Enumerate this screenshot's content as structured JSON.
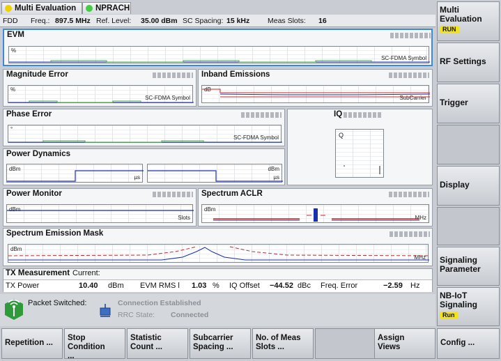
{
  "tabs": {
    "multi_eval": "Multi Evaluation",
    "nprach": "NPRACH"
  },
  "info": {
    "duplex": "FDD",
    "freq_label": "Freq.:",
    "freq_value": "897.5 MHz",
    "ref_label": "Ref. Level:",
    "ref_value": "35.00 dBm",
    "sc_label": "SC Spacing:",
    "sc_value": "15 kHz",
    "slots_label": "Meas Slots:",
    "slots_value": "16"
  },
  "panels": {
    "evm": {
      "title": "EVM",
      "y_unit": "%",
      "x_unit": "SC-FDMA Symbol"
    },
    "mag": {
      "title": "Magnitude Error",
      "y_unit": "%",
      "x_unit": "SC-FDMA Symbol"
    },
    "inband": {
      "title": "Inband Emissions",
      "y_unit": "dB",
      "x_unit": "SubCarrier"
    },
    "phase": {
      "title": "Phase Error",
      "y_unit": "°",
      "x_unit": "SC-FDMA Symbol"
    },
    "iq": {
      "title": "IQ",
      "q_label": "Q"
    },
    "pdyn": {
      "title": "Power Dynamics",
      "y_unit_left": "dBm",
      "x_unit_left": "µs",
      "y_unit_right": "dBm",
      "x_unit_right": "µs"
    },
    "pmon": {
      "title": "Power Monitor",
      "y_unit": "dBm",
      "x_unit": "Slots"
    },
    "aclr": {
      "title": "Spectrum ACLR",
      "y_unit": "dBm",
      "x_unit": "MHz"
    },
    "sem": {
      "title": "Spectrum Emission Mask",
      "y_unit": "dBm",
      "x_unit": "MHz"
    }
  },
  "tx": {
    "title": "TX Measurement",
    "mode": "Current:",
    "power_label": "TX Power",
    "power_value": "10.40",
    "power_unit": "dBm",
    "evm_label": "EVM RMS l",
    "evm_value": "1.03",
    "evm_unit": "%",
    "iq_label": "IQ Offset",
    "iq_value": "−44.52",
    "iq_unit": "dBc",
    "freq_label": "Freq. Error",
    "freq_value": "−2.59",
    "freq_unit": "Hz"
  },
  "status": {
    "ps_label": "Packet Switched:",
    "conn_label": "Connection Established",
    "rrc_label": "RRC State:",
    "rrc_value": "Connected"
  },
  "softkeys_right": {
    "multi_eval": "Multi Evaluation",
    "multi_eval_badge": "RUN",
    "rf": "RF Settings",
    "trigger": "Trigger",
    "display": "Display",
    "sig_param": "Signaling Parameter",
    "nbiot": "NB-IoT Signaling",
    "nbiot_badge": "Run"
  },
  "softkeys_bottom": {
    "repetition": "Repetition ...",
    "stop": "Stop Condition ...",
    "stat": "Statistic Count ...",
    "subcarrier": "Subcarrier Spacing ...",
    "meas_slots": "No. of Meas Slots ...",
    "assign": "Assign Views",
    "config": "Config ..."
  },
  "colors": {
    "run_badge": "#f2e21a",
    "green_led": "#3fcf3f",
    "yellow_led": "#f0d000",
    "trace_blue": "#1a2fb0",
    "trace_red": "#c0282c"
  }
}
